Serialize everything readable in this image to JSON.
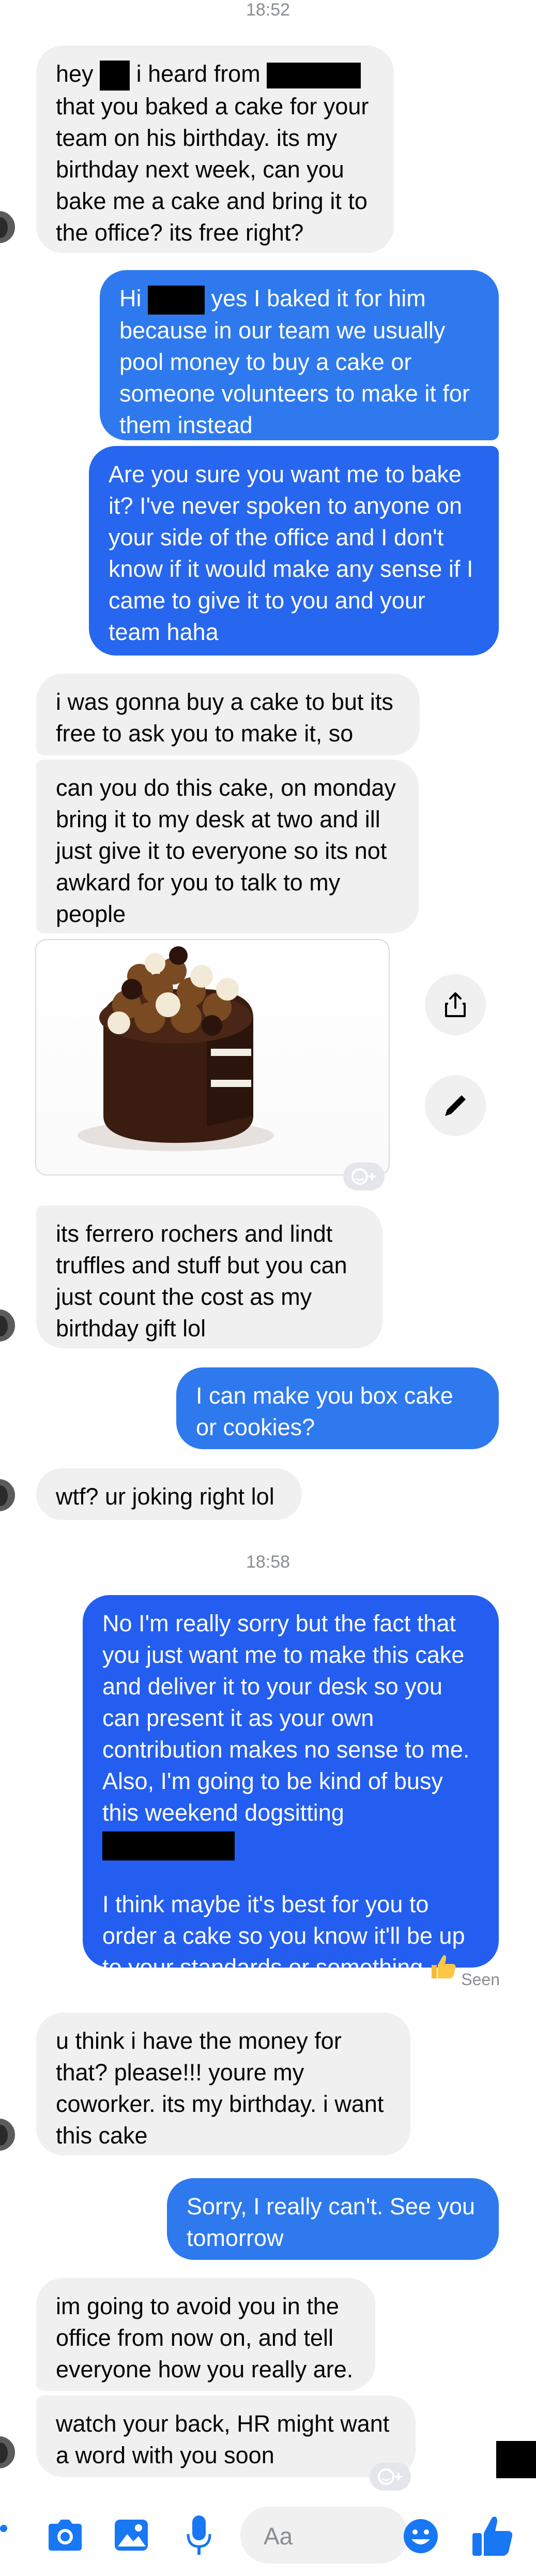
{
  "timestamps": {
    "first": "18:52",
    "second": "18:58"
  },
  "messages": {
    "m1_a": "hey",
    "m1_b": "i heard from",
    "m1_c": "that you baked a cake for your team on his birthday. its my birthday next week, can you bake me a cake and bring it to the office? its free right?",
    "m2_a": "Hi",
    "m2_b": "yes I baked it for him because in our team we usually pool money to buy a cake or someone volunteers to make it for them instead",
    "m3": "Are you sure you want me to bake it? I've never spoken to anyone on your side of the office and I don't know if it would make any sense if I came to give it to you and your team haha",
    "m4": "i was gonna buy a cake to but its free to ask you to make it, so",
    "m5": "can you do this cake, on monday bring it to my desk at two and ill just give it to everyone so its not awkard for you to talk to my people",
    "m6": "its ferrero rochers and lindt truffles and stuff but you can just count the cost as my birthday gift lol",
    "m7": "I can make you box cake or cookies?",
    "m8": "wtf? ur joking right lol",
    "m9_a": "No I'm really sorry but the fact that you just want me to make this cake and deliver it to your desk so you can present it as your own contribution makes no sense to me. Also, I'm going to be kind of busy this weekend dogsitting",
    "m9_b": "I think maybe it's best for you to order a cake so you know it'll be up to your standards or something",
    "m10": "u think i have the money for that? please!!! youre my coworker. its my birthday. i want this cake",
    "m11": "Sorry, I really can't. See you tomorrow",
    "m12": "im going to avoid you in the office from now on, and tell everyone how you really are.",
    "m13": "watch your back, HR might want a word with you soon"
  },
  "status": {
    "seen": "Seen"
  },
  "composer": {
    "placeholder": "Aa"
  },
  "icons": {
    "share": "share-icon",
    "edit": "pencil-icon",
    "react": "smiley-plus-icon",
    "menu": "dots-icon",
    "camera": "camera-icon",
    "gallery": "image-icon",
    "mic": "microphone-icon",
    "emoji": "emoji-icon",
    "like": "thumbs-up-icon"
  },
  "colors": {
    "incoming_bubble": "#f0f0f0",
    "outgoing_bubble": "#2e79ee",
    "accent": "#1877f2",
    "timestamp": "#8a8d91"
  }
}
